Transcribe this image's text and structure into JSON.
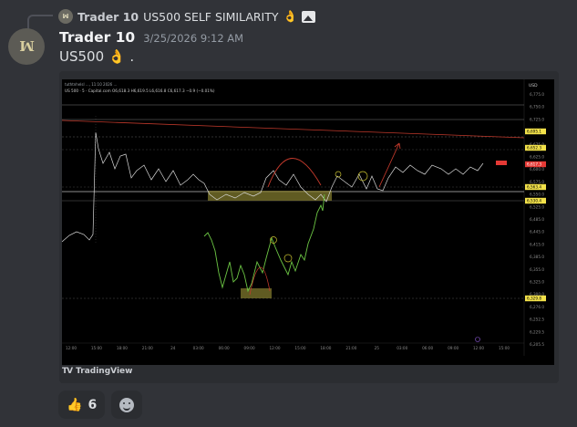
{
  "reply": {
    "avatar_glyph": "ꟽ",
    "author": "Trader 10",
    "text": "US500 SELF SIMILARITY",
    "emoji": "👌"
  },
  "message": {
    "avatar_glyph": "ꟽ",
    "author": "Trader 10",
    "timestamp": "3/25/2026 9:12 AM",
    "text": "US500",
    "emoji": "👌",
    "suffix": "."
  },
  "chart": {
    "header": "US 500 · 5 · Capital.com  O6,618.3  H6,619.5  L6,616.8  C6,617.3  −0.9 (−0.01%)",
    "watermark": "tuthtnhelsl ..., 11:10 2026 ...",
    "currency": "USD",
    "price_ticks": [
      "6,775.0",
      "6,750.0",
      "6,725.0",
      "6,700.0",
      "6,675.0",
      "6,625.0",
      "6,600.0",
      "6,575.0",
      "6,550.0",
      "6,525.0",
      "6,485.0",
      "6,445.0",
      "6,415.0",
      "6,385.0",
      "6,355.0",
      "6,325.0",
      "6,300.0",
      "6,276.0",
      "6,252.5",
      "6,229.5",
      "6,205.5"
    ],
    "price_tags": [
      {
        "label": "6,695.1",
        "kind": "yellow"
      },
      {
        "label": "6,652.3",
        "kind": "yellow"
      },
      {
        "label": "6,617.3",
        "kind": "red"
      },
      {
        "label": "6,563.4",
        "kind": "yellow"
      },
      {
        "label": "6,530.4",
        "kind": "yellow"
      },
      {
        "label": "6,329.8",
        "kind": "yellow"
      }
    ],
    "time_ticks": [
      "12:00",
      "15:00",
      "18:00",
      "21:00",
      "24",
      "03:00",
      "06:00",
      "09:00",
      "12:00",
      "15:00",
      "18:00",
      "21:00",
      "25",
      "03:00",
      "06:00",
      "09:00",
      "12:00",
      "15:00"
    ],
    "brand": "TradingView",
    "brand_logo": "TV",
    "colors": {
      "price": "#d8d8d8",
      "fractal": "#6cc644",
      "arc": "#c0392b",
      "zone": "#807a2e",
      "tag_yellow": "#f2e14a",
      "tag_red": "#e53935"
    }
  },
  "reactions": [
    {
      "emoji": "👍",
      "count": "6"
    }
  ]
}
